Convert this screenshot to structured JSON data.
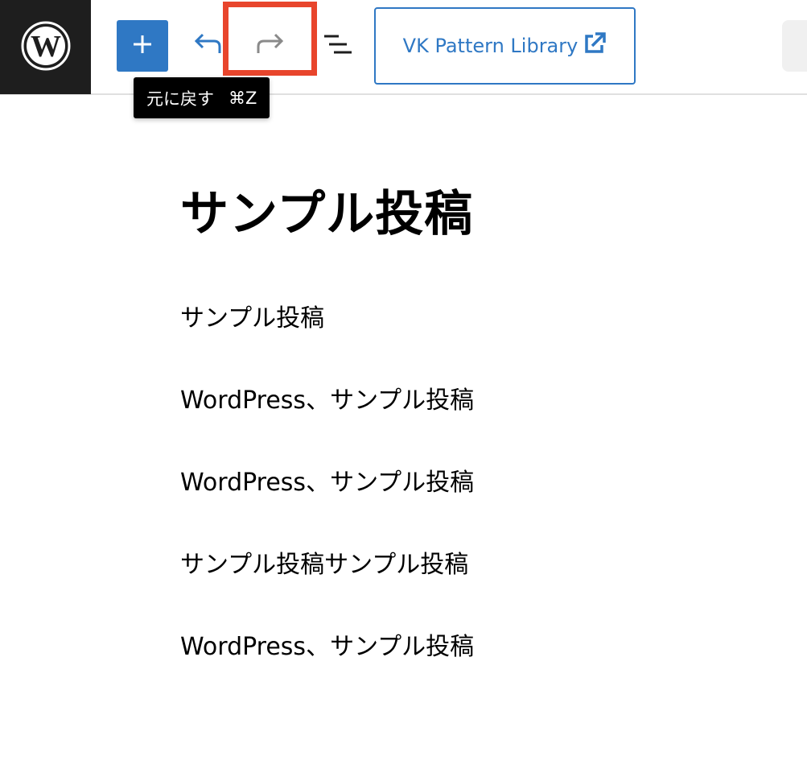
{
  "toolbar": {
    "add_block_label": "+",
    "pattern_library_label": "VK Pattern Library",
    "colors": {
      "accent": "#2f78c4",
      "logo_background": "#1e1e1e",
      "highlight": "#e8452c"
    },
    "icons": {
      "logo": "wordpress-logo-icon",
      "undo": "undo-icon",
      "redo": "redo-icon",
      "list_view": "list-view-icon",
      "external": "external-link-icon"
    }
  },
  "tooltip": {
    "label": "元に戻す",
    "shortcut": "⌘Z"
  },
  "post": {
    "title": "サンプル投稿",
    "paragraphs": [
      "サンプル投稿",
      "WordPress、サンプル投稿",
      "WordPress、サンプル投稿",
      "サンプル投稿サンプル投稿",
      "WordPress、サンプル投稿"
    ]
  }
}
